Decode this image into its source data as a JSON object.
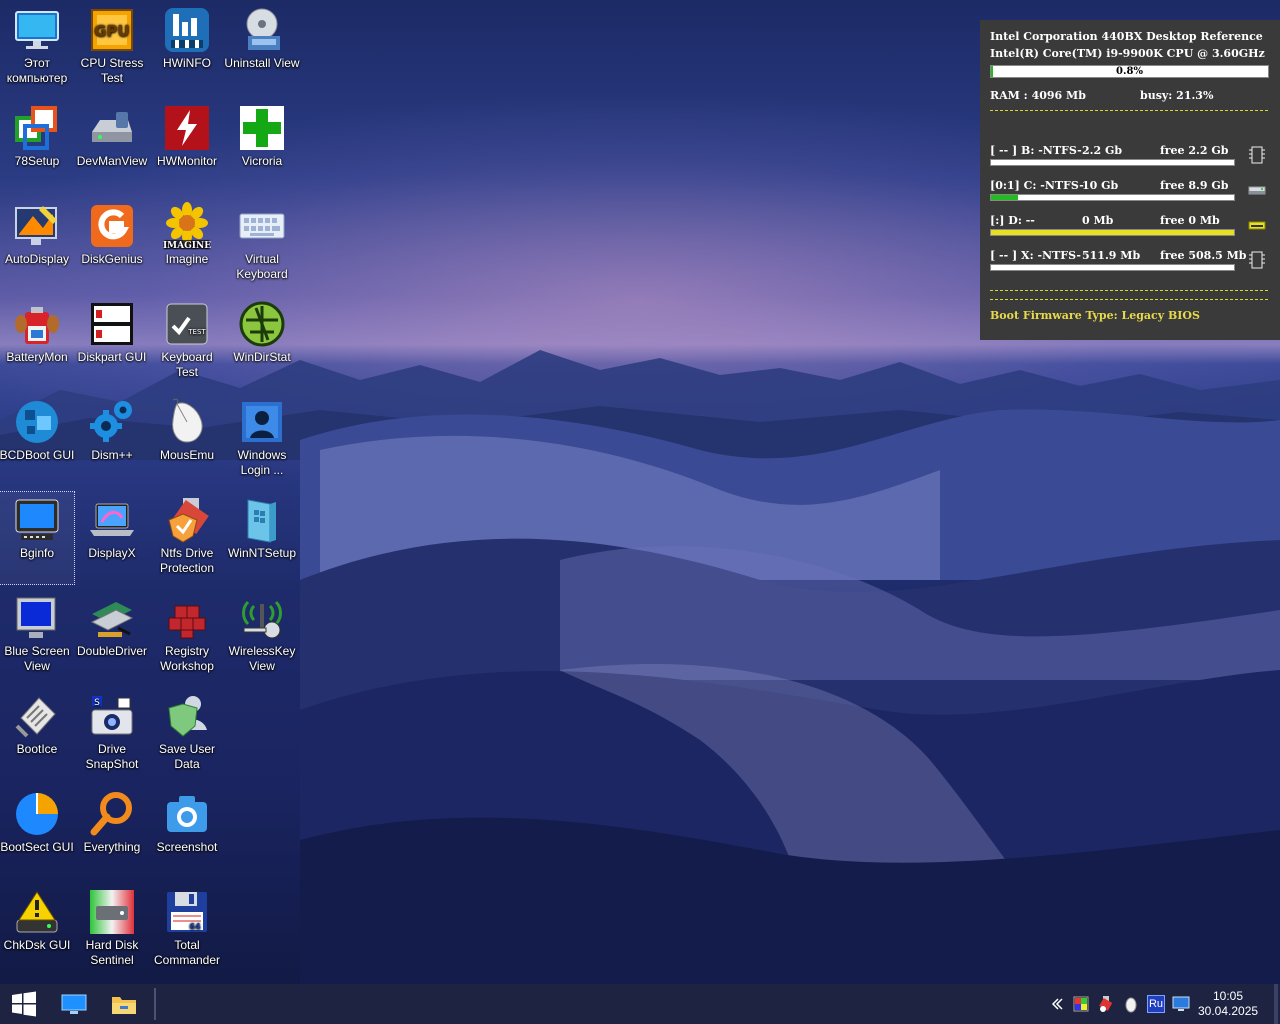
{
  "desktop_icons": [
    {
      "label": "Этот компьютер",
      "icon": "computer-icon"
    },
    {
      "label": "CPU Stress Test",
      "icon": "gpu-chip-icon"
    },
    {
      "label": "HWiNFO",
      "icon": "hwinfo-icon"
    },
    {
      "label": "Uninstall View",
      "icon": "uninstall-disc-icon"
    },
    {
      "label": "78Setup",
      "icon": "windows-setup-icon"
    },
    {
      "label": "DevManView",
      "icon": "device-manager-icon"
    },
    {
      "label": "HWMonitor",
      "icon": "hwmonitor-icon"
    },
    {
      "label": "Vicroria",
      "icon": "green-cross-icon"
    },
    {
      "label": "AutoDisplay",
      "icon": "display-paint-icon"
    },
    {
      "label": "DiskGenius",
      "icon": "diskgenius-icon"
    },
    {
      "label": "Imagine",
      "icon": "sunflower-icon"
    },
    {
      "label": "Virtual Keyboard",
      "icon": "keyboard-icon"
    },
    {
      "label": "BatteryMon",
      "icon": "battery-icon"
    },
    {
      "label": "Diskpart GUI",
      "icon": "diskpart-icon"
    },
    {
      "label": "Keyboard Test",
      "icon": "keyboard-test-icon"
    },
    {
      "label": "WinDirStat",
      "icon": "windirstat-icon"
    },
    {
      "label": "BCDBoot GUI",
      "icon": "bcdboot-icon"
    },
    {
      "label": "Dism++",
      "icon": "gears-icon"
    },
    {
      "label": "MousEmu",
      "icon": "mouse-icon"
    },
    {
      "label": "Windows Login ...",
      "icon": "windows-login-icon"
    },
    {
      "label": "Bginfo",
      "icon": "monitor-icon"
    },
    {
      "label": "DisplayX",
      "icon": "laptop-icon"
    },
    {
      "label": "Ntfs Drive Protection",
      "icon": "usb-shield-icon"
    },
    {
      "label": "WinNTSetup",
      "icon": "winntsetup-icon"
    },
    {
      "label": "Blue Screen View",
      "icon": "blue-screen-icon"
    },
    {
      "label": "DoubleDriver",
      "icon": "driver-board-icon"
    },
    {
      "label": "Registry Workshop",
      "icon": "registry-cubes-icon"
    },
    {
      "label": "WirelessKey View",
      "icon": "wireless-key-icon"
    },
    {
      "label": "BootIce",
      "icon": "bootice-icon"
    },
    {
      "label": "Drive SnapShot",
      "icon": "drive-snapshot-icon"
    },
    {
      "label": "Save User Data",
      "icon": "user-shield-icon"
    },
    {
      "label": "",
      "icon": ""
    },
    {
      "label": "BootSect GUI",
      "icon": "pie-chart-icon"
    },
    {
      "label": "Everything",
      "icon": "magnifier-icon"
    },
    {
      "label": "Screenshot",
      "icon": "camera-icon"
    },
    {
      "label": "",
      "icon": ""
    },
    {
      "label": "ChkDsk GUI",
      "icon": "warning-drive-icon"
    },
    {
      "label": "Hard Disk Sentinel",
      "icon": "hdd-sentinel-icon"
    },
    {
      "label": "Total Commander",
      "icon": "floppy-icon"
    }
  ],
  "bginfo": {
    "board": "Intel Corporation 440BX Desktop Reference",
    "cpu": "Intel(R) Core(TM) i9-9900K CPU @ 3.60GHz",
    "cpu_load": "0.8%",
    "cpu_load_value": 0.008,
    "ram": "RAM : 4096 Mb",
    "busy": "busy: 21.3%",
    "drives": [
      {
        "label": "[ -- ]  B:  -NTFS-",
        "size": "2.2 Gb",
        "free": "free 2.2 Gb",
        "used_fraction": 0.0,
        "fill_color": "#ffffff",
        "icon": "memory-chip-icon"
      },
      {
        "label": "[0:1]  C:  -NTFS-",
        "size": "10 Gb",
        "free": "free 8.9 Gb",
        "used_fraction": 0.11,
        "fill_color": "#22bb22",
        "icon": "hard-drive-icon"
      },
      {
        "label": "[:]  D:  --",
        "size": "0 Mb",
        "free": "free 0 Mb",
        "used_fraction": 1.0,
        "fill_color": "#e6e020",
        "icon": "optical-drive-icon"
      },
      {
        "label": "[ -- ]  X:  -NTFS-",
        "size": "511.9 Mb",
        "free": "free 508.5 Mb",
        "used_fraction": 0.01,
        "fill_color": "#ffffff",
        "icon": "memory-chip-icon"
      }
    ],
    "firmware": "Boot Firmware Type: Legacy BIOS",
    "accent_color": "#e6d94a"
  },
  "taskbar": {
    "start_icon": "windows-logo-icon",
    "pinned": [
      {
        "name": "monitor-app-icon"
      },
      {
        "name": "file-explorer-icon"
      }
    ],
    "tray": [
      {
        "name": "chevron-left-icon"
      },
      {
        "name": "color-app-icon"
      },
      {
        "name": "usb-tray-icon"
      },
      {
        "name": "mouse-tray-icon"
      },
      {
        "name": "language-icon",
        "text": "Ru"
      },
      {
        "name": "display-tray-icon"
      }
    ],
    "time": "10:05",
    "date": "30.04.2025"
  }
}
